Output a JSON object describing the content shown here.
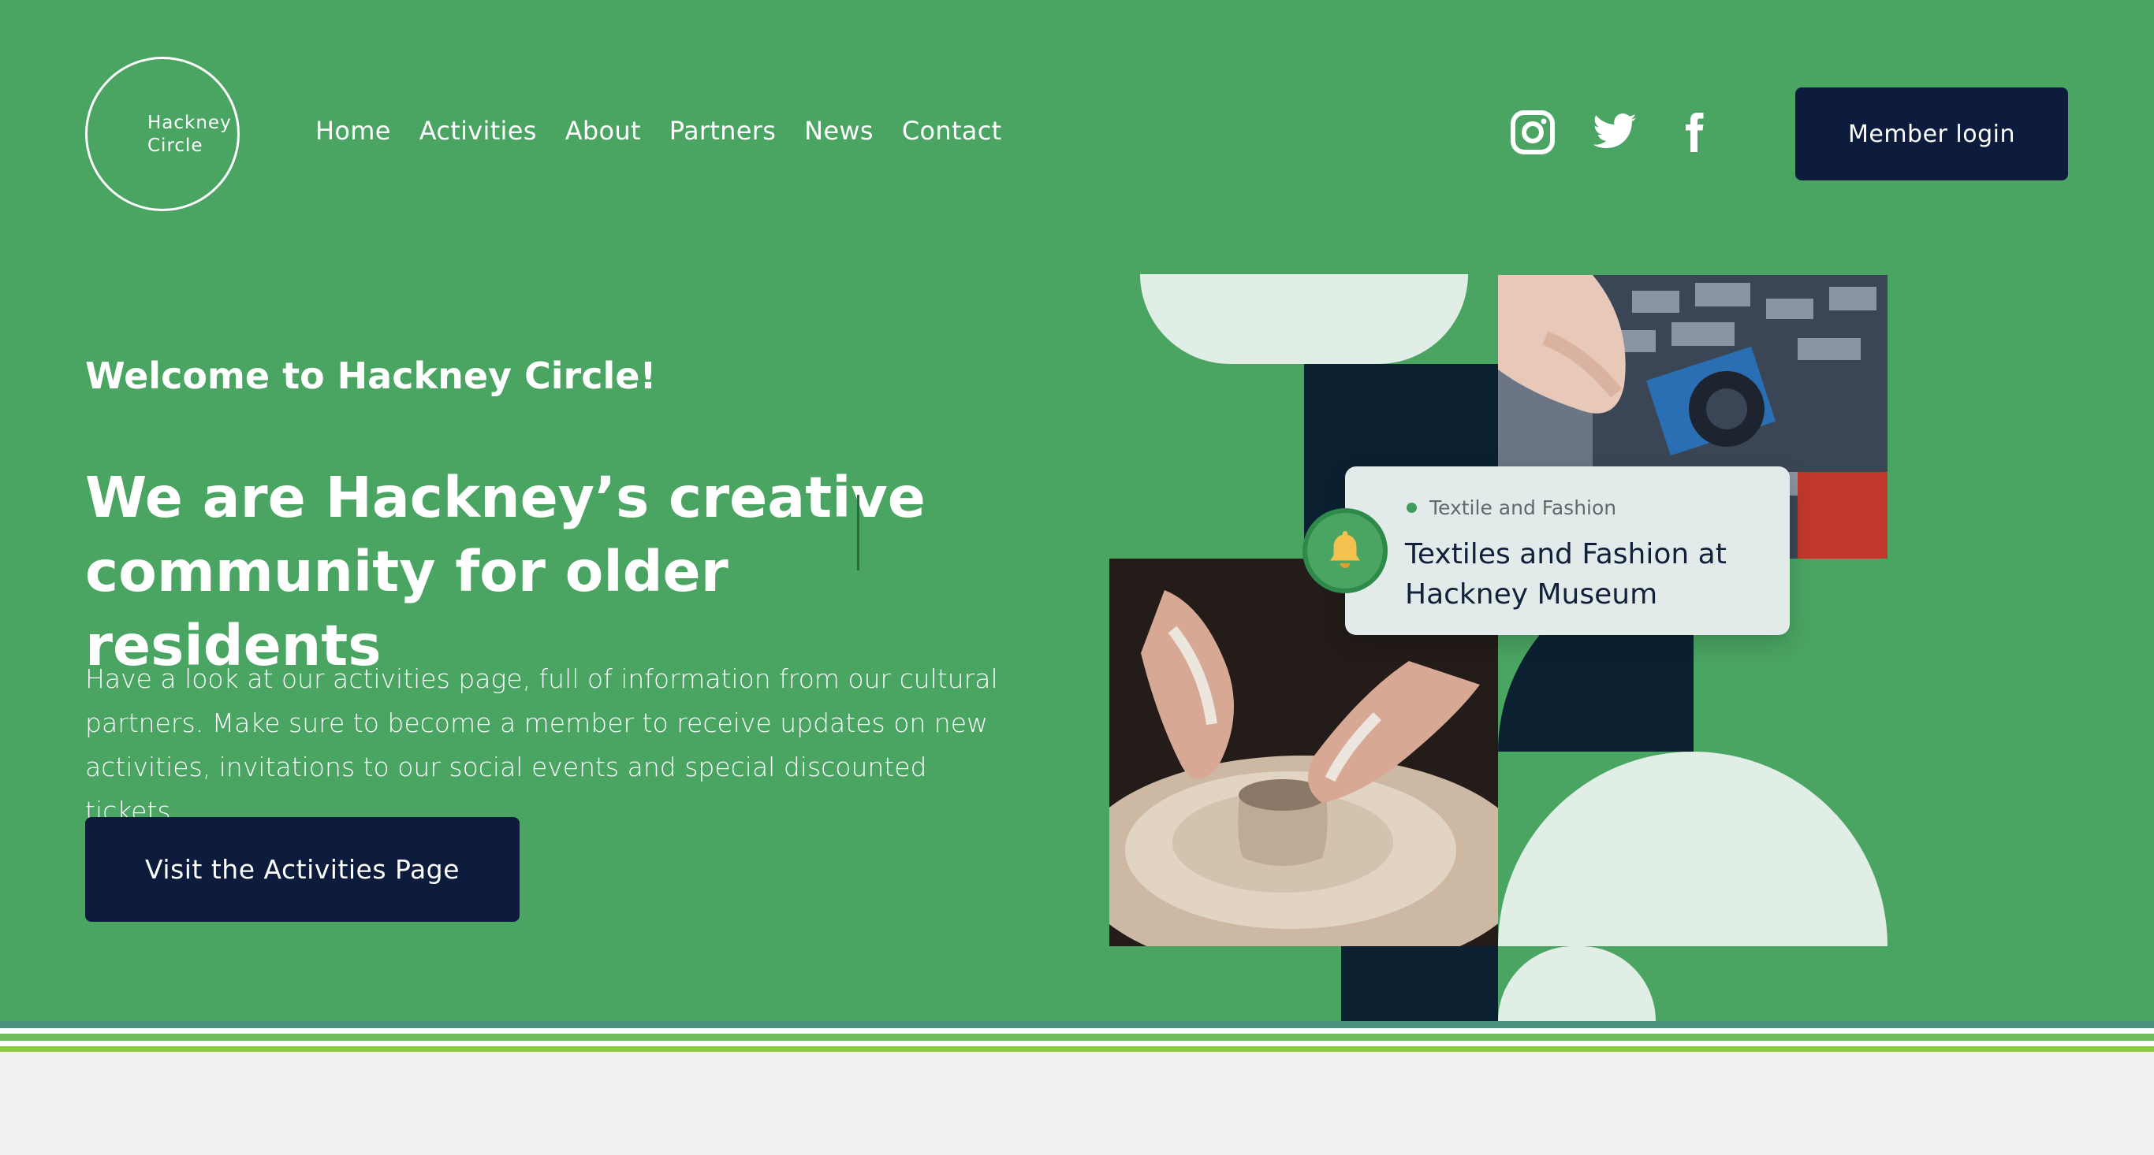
{
  "brand": {
    "line1": "Hackney",
    "line2": "Circle"
  },
  "nav": [
    "Home",
    "Activities",
    "About",
    "Partners",
    "News",
    "Contact"
  ],
  "social": [
    {
      "icon": "instagram-icon"
    },
    {
      "icon": "twitter-icon"
    },
    {
      "icon": "facebook-icon"
    }
  ],
  "header": {
    "member_login": "Member login"
  },
  "hero": {
    "eyebrow": "Welcome to Hackney Circle!",
    "headline": "We are Hackney’s creative community for older residents",
    "intro": "Have a look at our activities page, full of information from our cultural partners. Make sure to become a member to receive updates on new activities, invitations to our social events and special discounted tickets.",
    "cta": "Visit the Activities Page"
  },
  "event_card": {
    "tag": "Textile and Fashion",
    "title": "Textiles and Fashion at Hackney Museum",
    "icon": "bell-icon"
  },
  "colors": {
    "hero_green": "#4aa462",
    "navy": "#0d1c3d",
    "dark_teal": "#0b2131",
    "pale_mint": "#e0eee6",
    "footer_grey": "#f0f0f0"
  }
}
